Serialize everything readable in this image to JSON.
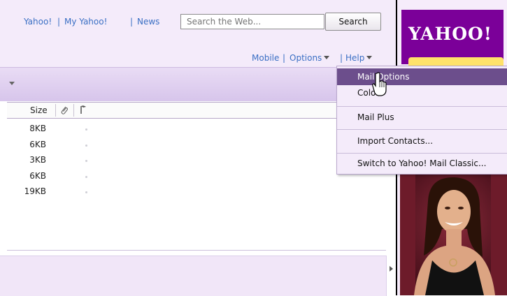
{
  "header": {
    "links": [
      "Yahoo!",
      "My Yahoo!",
      "News"
    ],
    "separator": "|",
    "search_placeholder": "Search the Web...",
    "search_button": "Search",
    "sublinks": {
      "mobile": "Mobile",
      "options": "Options",
      "help": "Help"
    }
  },
  "columns": {
    "size": "Size",
    "attachment_icon": "paperclip-icon",
    "flag_icon": "flag-icon"
  },
  "rows": [
    "8KB",
    "6KB",
    "3KB",
    "6KB",
    "19KB"
  ],
  "sidebar": {
    "logo": "YAHOO!"
  },
  "dropdown": {
    "items": [
      "Mail Options",
      "Colors",
      "Mail Plus",
      "Import Contacts...",
      "Switch to Yahoo! Mail Classic..."
    ]
  },
  "colors": {
    "header_bg": "#f4ebfa",
    "link": "#3a6fc4",
    "menu_highlight": "#6c4e8c",
    "yahoo_purple": "#7b0099"
  }
}
